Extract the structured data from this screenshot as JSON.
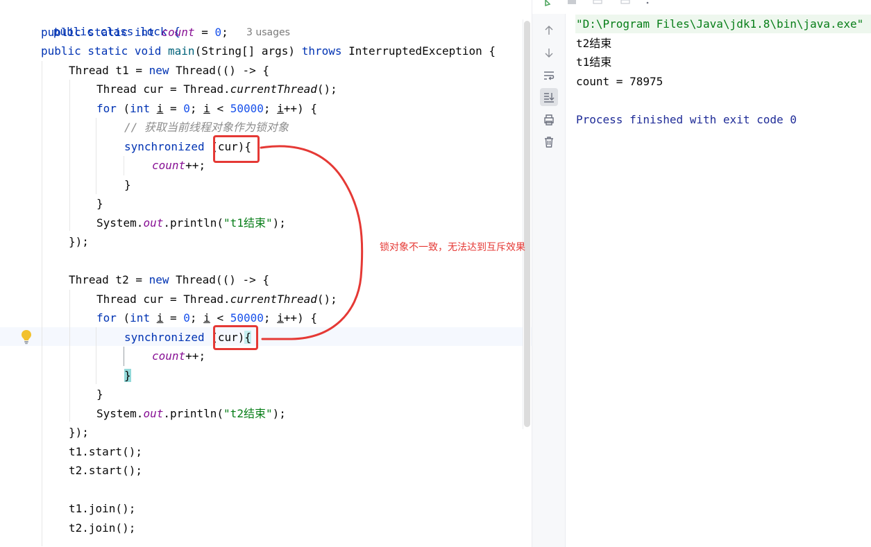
{
  "editor": {
    "usage_hint": "3 usages",
    "lines": {
      "l1": "public class lock {",
      "l2_kw1": "public static int ",
      "l2_field": "count",
      "l2_rest": " = ",
      "l2_num": "0",
      "l2_end": ";",
      "l3_kw": "public static void ",
      "l3_name": "main",
      "l3_mid": "(String[] args) ",
      "l3_throws": "throws",
      "l3_end": " InterruptedException {",
      "t1_decl_a": "Thread t1 = ",
      "t2_decl_a": "Thread t2 = ",
      "new_kw": "new",
      "decl_b": " Thread(() -> {",
      "cur_decl_a": "Thread cur = Thread.",
      "cur_decl_method": "currentThread",
      "cur_decl_end": "();",
      "for_kw": "for",
      "for_paren": " (",
      "int_kw": "int",
      "var_i": "i",
      "for_eq": " = ",
      "for_zero": "0",
      "for_semi": "; ",
      "for_lt": " < ",
      "for_limit": "50000",
      "for_semi2": "; ",
      "for_inc": "++) {",
      "comment": "// 获取当前线程对象作为锁对象",
      "sync_kw": "synchronized",
      "sync_arg": " (cur)",
      "open_brace": "{",
      "count_field": "count",
      "count_inc": "++;",
      "close_brace": "}",
      "println_a": "System.",
      "println_out": "out",
      "println_b": ".println(",
      "t1_msg": "\"t1结束\"",
      "t2_msg": "\"t2结束\"",
      "println_end": ");",
      "lambda_end": "});",
      "t1_start": "t1.start();",
      "t2_start": "t2.start();",
      "t1_join": "t1.join();",
      "t2_join": "t2.join();"
    }
  },
  "annotation": {
    "text": "锁对象不一致，无法达到互斥效果",
    "color": "#e53935"
  },
  "run_panel": {
    "command": "\"D:\\Program Files\\Java\\jdk1.8\\bin\\java.exe\"",
    "output": [
      "t2结束",
      "t1结束",
      "count = 78975"
    ],
    "exit_message": "Process finished with exit code 0",
    "toolbar_icons": [
      "arrow-up-icon",
      "arrow-down-icon",
      "soft-wrap-icon",
      "scroll-to-end-icon",
      "print-icon",
      "trash-icon"
    ]
  },
  "colors": {
    "keyword": "#0033b3",
    "number": "#1750eb",
    "string": "#067d17",
    "field": "#871094",
    "comment": "#8c8c8c",
    "exit_text": "#1e2b97"
  }
}
